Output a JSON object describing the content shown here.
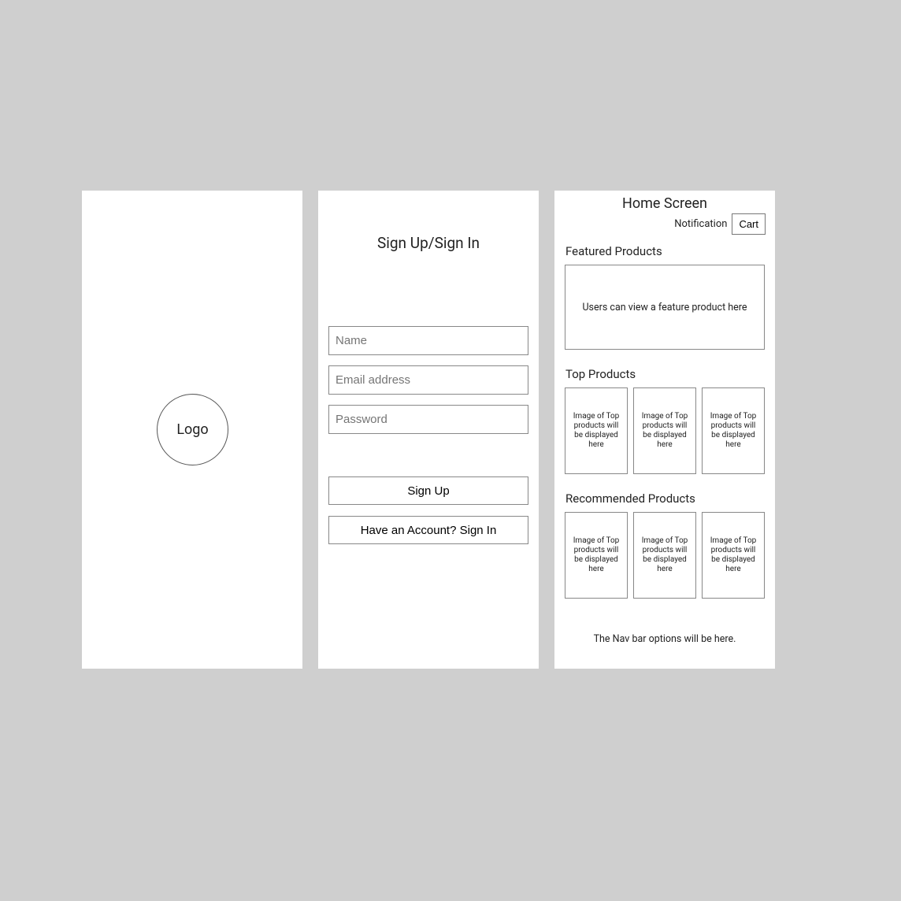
{
  "splash": {
    "logo_label": "Logo"
  },
  "signup": {
    "title": "Sign Up/Sign In",
    "name_placeholder": "Name",
    "email_placeholder": "Email address",
    "password_placeholder": "Password",
    "signup_button": "Sign Up",
    "signin_button": "Have an Account? Sign In"
  },
  "home": {
    "title": "Home Screen",
    "notification_label": "Notification",
    "cart_label": "Cart",
    "featured_title": "Featured Products",
    "featured_text": "Users can view a feature product here",
    "top_title": "Top Products",
    "top_products": [
      "Image of Top products will be displayed here",
      "Image of Top products will be displayed here",
      "Image of Top products will be displayed here"
    ],
    "recommended_title": "Recommended Products",
    "recommended_products": [
      "Image of Top products will be displayed here",
      "Image of Top products will be displayed here",
      "Image of Top products will be displayed here"
    ],
    "navbar_note": "The Nav bar options will be here."
  }
}
